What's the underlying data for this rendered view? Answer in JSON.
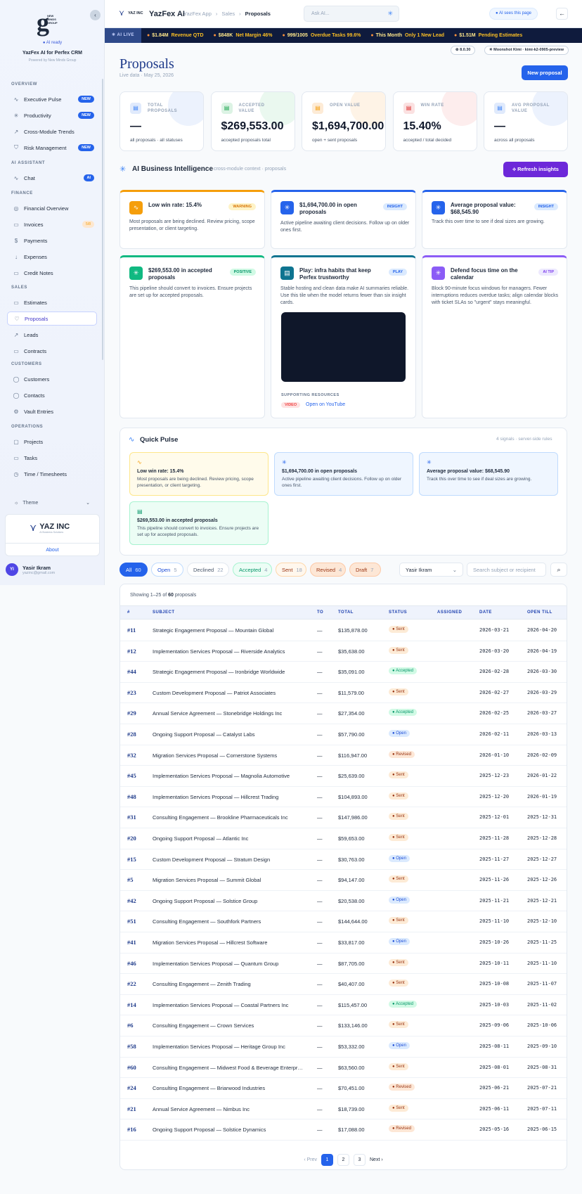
{
  "sidebar": {
    "logo_text": "NEW MINDS GROUP",
    "ai_ready": "AI ready",
    "app_name": "YazFex AI for Perfex CRM",
    "powered": "Powered by New Minds Group",
    "sections": [
      {
        "label": "OVERVIEW",
        "items": [
          {
            "label": "Executive Pulse",
            "badge": "NEW",
            "icon": "pulse-icon"
          },
          {
            "label": "Productivity",
            "badge": "NEW",
            "icon": "sparkle-icon"
          },
          {
            "label": "Cross-Module Trends",
            "icon": "trend-icon"
          },
          {
            "label": "Risk Management",
            "badge": "NEW",
            "icon": "shield-icon"
          }
        ]
      },
      {
        "label": "AI ASSISTANT",
        "items": [
          {
            "label": "Chat",
            "badge": "AI",
            "icon": "pulse-icon"
          }
        ]
      },
      {
        "label": "FINANCE",
        "items": [
          {
            "label": "Financial Overview",
            "icon": "circle-icon"
          },
          {
            "label": "Invoices",
            "soft": "5/8",
            "icon": "doc-icon"
          },
          {
            "label": "Payments",
            "icon": "dollar-icon"
          },
          {
            "label": "Expenses",
            "icon": "arrow-down-icon"
          },
          {
            "label": "Credit Notes",
            "icon": "doc-icon"
          }
        ]
      },
      {
        "label": "SALES",
        "items": [
          {
            "label": "Estimates",
            "icon": "doc-icon"
          },
          {
            "label": "Proposals",
            "active": true,
            "icon": "thumb-icon"
          },
          {
            "label": "Leads",
            "icon": "trend-icon"
          },
          {
            "label": "Contracts",
            "icon": "doc-icon"
          }
        ]
      },
      {
        "label": "CUSTOMERS",
        "items": [
          {
            "label": "Customers",
            "icon": "user-icon"
          },
          {
            "label": "Contacts",
            "icon": "user-icon"
          },
          {
            "label": "Vault Entries",
            "icon": "gear-icon"
          }
        ]
      },
      {
        "label": "OPERATIONS",
        "items": [
          {
            "label": "Projects",
            "icon": "folder-icon"
          },
          {
            "label": "Tasks",
            "icon": "doc-icon"
          },
          {
            "label": "Time / Timesheets",
            "icon": "clock-icon"
          }
        ]
      }
    ],
    "theme": "Theme",
    "company": "YAZ INC",
    "company_sub": "AI Business Solutions",
    "about": "About",
    "user": {
      "initials": "YI",
      "name": "Yasir Ikram",
      "email": "yazinc@gmail.com"
    }
  },
  "header": {
    "brand": "YAZ INC",
    "title": "YazFex AI",
    "crumbs": [
      "YazFex App",
      "Sales",
      "Proposals"
    ],
    "search_placeholder": "Ask AI...",
    "ai_sees": "AI sees this page"
  },
  "ticker": {
    "live": "AI LIVE",
    "items": [
      {
        "val": "$1.84M",
        "label": "Revenue QTD"
      },
      {
        "val": "$848K",
        "label": "Net Margin 46%"
      },
      {
        "val": "999/1005",
        "label": "Overdue Tasks 99.6%"
      },
      {
        "val": "This Month",
        "label": "Only 1 New Lead"
      },
      {
        "val": "$1.51M",
        "label": "Pending Estimates"
      }
    ]
  },
  "meta": {
    "version": "8.0.30",
    "model": "Moonshot Kimi · kimi-k2-0905-preview"
  },
  "page": {
    "title": "Proposals",
    "subtitle": "Live data · May 25, 2026",
    "new_button": "New proposal"
  },
  "kpis": [
    {
      "label": "TOTAL PROPOSALS",
      "value": "—",
      "sub": "all proposals · all statuses",
      "color": "#3b82f6",
      "bg": "#e0eafc"
    },
    {
      "label": "ACCEPTED VALUE",
      "value": "$269,553.00",
      "sub": "accepted proposals total",
      "color": "#16a34a",
      "bg": "#dcf3e4"
    },
    {
      "label": "OPEN VALUE",
      "value": "$1,694,700.00",
      "sub": "open + sent proposals",
      "color": "#f59e0b",
      "bg": "#fdebd6"
    },
    {
      "label": "WIN RATE",
      "value": "15.40%",
      "sub": "accepted / total decided",
      "color": "#dc2626",
      "bg": "#fbe1e1"
    },
    {
      "label": "AVG PROPOSAL VALUE",
      "value": "—",
      "sub": "across all proposals",
      "color": "#3b82f6",
      "bg": "#e0eafc"
    }
  ],
  "ai_bi": {
    "title": "AI Business Intelligence",
    "subtitle": "cross-module context · proposals",
    "refresh": "Refresh insights"
  },
  "insights": [
    {
      "title": "Low win rate: 15.4%",
      "tag": "WARNING",
      "desc": "Most proposals are being declined. Review pricing, scope presentation, or client targeting.",
      "color": "#f59e0b"
    },
    {
      "title": "$1,694,700.00 in open proposals",
      "tag": "INSIGHT",
      "desc": "Active pipeline awaiting client decisions. Follow up on older ones first.",
      "color": "#2563eb"
    },
    {
      "title": "Average proposal value: $68,545.90",
      "tag": "INSIGHT",
      "desc": "Track this over time to see if deal sizes are growing.",
      "color": "#2563eb"
    },
    {
      "title": "$269,553.00 in accepted proposals",
      "tag": "POSITIVE",
      "desc": "This pipeline should convert to invoices. Ensure projects are set up for accepted proposals.",
      "color": "#10b981"
    },
    {
      "title": "Play: infra habits that keep Perfex trustworthy",
      "tag": "PLAY",
      "desc": "Stable hosting and clean data make AI summaries reliable. Use this tile when the model returns fewer than six insight cards.",
      "color": "#0e7490"
    },
    {
      "title": "Defend focus time on the calendar",
      "tag": "AI TIP",
      "desc": "Block 90-minute focus windows for managers. Fewer interruptions reduces overdue tasks; align calendar blocks with ticket SLAs so \"urgent\" stays meaningful.",
      "color": "#8b5cf6"
    }
  ],
  "resources": {
    "label": "SUPPORTING RESOURCES",
    "tag": "VIDEO",
    "link": "Open on YouTube"
  },
  "quick_pulse": {
    "title": "Quick Pulse",
    "meta": "4 signals · server-side rules",
    "items": [
      {
        "title": "Low win rate: 15.4%",
        "desc": "Most proposals are being declined. Review pricing, scope presentation, or client targeting."
      },
      {
        "title": "$1,694,700.00 in open proposals",
        "desc": "Active pipeline awaiting client decisions. Follow up on older ones first."
      },
      {
        "title": "Average proposal value: $68,545.90",
        "desc": "Track this over time to see if deal sizes are growing."
      },
      {
        "title": "$269,553.00 in accepted proposals",
        "desc": "This pipeline should convert to invoices. Ensure projects are set up for accepted proposals."
      }
    ]
  },
  "filters": [
    {
      "label": "All",
      "count": "60"
    },
    {
      "label": "Open",
      "count": "5"
    },
    {
      "label": "Declined",
      "count": "22"
    },
    {
      "label": "Accepted",
      "count": "4"
    },
    {
      "label": "Sent",
      "count": "18"
    },
    {
      "label": "Revised",
      "count": "4"
    },
    {
      "label": "Draft",
      "count": "7"
    }
  ],
  "owner": "Yasir Ikram",
  "table_search_placeholder": "Search subject or recipient",
  "table": {
    "showing_pre": "Showing 1–25 of ",
    "showing_total": "60",
    "showing_post": " proposals",
    "headers": [
      "#",
      "SUBJECT",
      "TO",
      "TOTAL",
      "STATUS",
      "ASSIGNED",
      "DATE",
      "OPEN TILL"
    ],
    "rows": [
      [
        "#11",
        "Strategic Engagement Proposal — Mountain Global",
        "—",
        "$135,878.00",
        "Sent",
        "",
        "2026-03-21",
        "2026-04-20"
      ],
      [
        "#12",
        "Implementation Services Proposal — Riverside Analytics",
        "—",
        "$35,638.00",
        "Sent",
        "",
        "2026-03-20",
        "2026-04-19"
      ],
      [
        "#44",
        "Strategic Engagement Proposal — Ironbridge Worldwide",
        "—",
        "$35,091.00",
        "Accepted",
        "",
        "2026-02-28",
        "2026-03-30"
      ],
      [
        "#23",
        "Custom Development Proposal — Patriot Associates",
        "—",
        "$11,579.00",
        "Sent",
        "",
        "2026-02-27",
        "2026-03-29"
      ],
      [
        "#29",
        "Annual Service Agreement — Stonebridge Holdings Inc",
        "—",
        "$27,354.00",
        "Accepted",
        "",
        "2026-02-25",
        "2026-03-27"
      ],
      [
        "#28",
        "Ongoing Support Proposal — Catalyst Labs",
        "—",
        "$57,790.00",
        "Open",
        "",
        "2026-02-11",
        "2026-03-13"
      ],
      [
        "#32",
        "Migration Services Proposal — Cornerstone Systems",
        "—",
        "$116,947.00",
        "Revised",
        "",
        "2026-01-10",
        "2026-02-09"
      ],
      [
        "#45",
        "Implementation Services Proposal — Magnolia Automotive",
        "—",
        "$25,639.00",
        "Sent",
        "",
        "2025-12-23",
        "2026-01-22"
      ],
      [
        "#48",
        "Implementation Services Proposal — Hillcrest Trading",
        "—",
        "$104,893.00",
        "Sent",
        "",
        "2025-12-20",
        "2026-01-19"
      ],
      [
        "#31",
        "Consulting Engagement — Brookline Pharmaceuticals Inc",
        "—",
        "$147,986.00",
        "Sent",
        "",
        "2025-12-01",
        "2025-12-31"
      ],
      [
        "#20",
        "Ongoing Support Proposal — Atlantic Inc",
        "—",
        "$59,653.00",
        "Sent",
        "",
        "2025-11-28",
        "2025-12-28"
      ],
      [
        "#15",
        "Custom Development Proposal — Stratum Design",
        "—",
        "$30,763.00",
        "Open",
        "",
        "2025-11-27",
        "2025-12-27"
      ],
      [
        "#5",
        "Migration Services Proposal — Summit Global",
        "—",
        "$94,147.00",
        "Sent",
        "",
        "2025-11-26",
        "2025-12-26"
      ],
      [
        "#42",
        "Ongoing Support Proposal — Solstice Group",
        "—",
        "$20,538.00",
        "Open",
        "",
        "2025-11-21",
        "2025-12-21"
      ],
      [
        "#51",
        "Consulting Engagement — Southfork Partners",
        "—",
        "$144,644.00",
        "Sent",
        "",
        "2025-11-10",
        "2025-12-10"
      ],
      [
        "#41",
        "Migration Services Proposal — Hillcrest Software",
        "—",
        "$33,817.00",
        "Open",
        "",
        "2025-10-26",
        "2025-11-25"
      ],
      [
        "#46",
        "Implementation Services Proposal — Quantum Group",
        "—",
        "$87,705.00",
        "Sent",
        "",
        "2025-10-11",
        "2025-11-10"
      ],
      [
        "#22",
        "Consulting Engagement — Zenith Trading",
        "—",
        "$40,407.00",
        "Sent",
        "",
        "2025-10-08",
        "2025-11-07"
      ],
      [
        "#14",
        "Implementation Services Proposal — Coastal Partners Inc",
        "—",
        "$115,457.00",
        "Accepted",
        "",
        "2025-10-03",
        "2025-11-02"
      ],
      [
        "#6",
        "Consulting Engagement — Crown Services",
        "—",
        "$133,146.00",
        "Sent",
        "",
        "2025-09-06",
        "2025-10-06"
      ],
      [
        "#58",
        "Implementation Services Proposal — Heritage Group Inc",
        "—",
        "$53,332.00",
        "Open",
        "",
        "2025-08-11",
        "2025-09-10"
      ],
      [
        "#60",
        "Consulting Engagement — Midwest Food & Beverage Enterprises",
        "—",
        "$63,560.00",
        "Sent",
        "",
        "2025-08-01",
        "2025-08-31"
      ],
      [
        "#24",
        "Consulting Engagement — Briarwood Industries",
        "—",
        "$70,451.00",
        "Revised",
        "",
        "2025-06-21",
        "2025-07-21"
      ],
      [
        "#21",
        "Annual Service Agreement — Nimbus Inc",
        "—",
        "$18,739.00",
        "Sent",
        "",
        "2025-06-11",
        "2025-07-11"
      ],
      [
        "#16",
        "Ongoing Support Proposal — Solstice Dynamics",
        "—",
        "$17,088.00",
        "Revised",
        "",
        "2025-05-16",
        "2025-06-15"
      ]
    ]
  },
  "pagination": {
    "prev": "‹ Prev",
    "pages": [
      "1",
      "2",
      "3"
    ],
    "next": "Next ›"
  }
}
